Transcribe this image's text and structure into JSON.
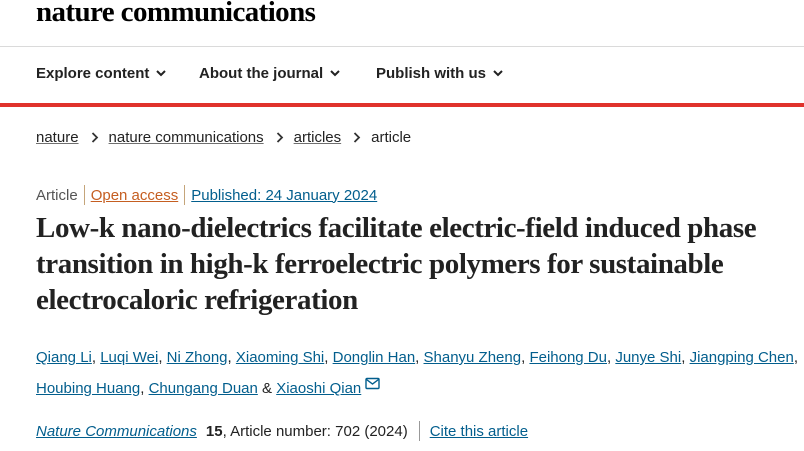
{
  "site": {
    "logo": "nature communications"
  },
  "nav": {
    "items": [
      {
        "label": "Explore content"
      },
      {
        "label": "About the journal"
      },
      {
        "label": "Publish with us"
      }
    ]
  },
  "breadcrumb": {
    "items": [
      "nature",
      "nature communications",
      "articles"
    ],
    "current": "article"
  },
  "article": {
    "type": "Article",
    "access": "Open access",
    "published": "Published: 24 January 2024",
    "title": "Low-k nano-dielectrics facilitate electric-field induced phase transition in high-k ferroelectric polymers for sustainable electrocaloric refrigeration",
    "authors": [
      "Qiang Li",
      "Luqi Wei",
      "Ni Zhong",
      "Xiaoming Shi",
      "Donglin Han",
      "Shanyu Zheng",
      "Feihong Du",
      "Junye Shi",
      "Jiangping Chen",
      "Houbing Huang",
      "Chungang Duan",
      "Xiaoshi Qian"
    ],
    "journal": "Nature Communications",
    "volume": "15",
    "article_number": ", Article number: 702 (2024)",
    "cite_label": "Cite this article"
  },
  "colors": {
    "accent_red": "#e0322c",
    "link_blue": "#025e8d",
    "open_access_orange": "#c55e21"
  },
  "icons": {
    "nav_chevron": "chevron-down-icon",
    "breadcrumb_sep": "chevron-right-icon",
    "contact": "mail-icon"
  }
}
